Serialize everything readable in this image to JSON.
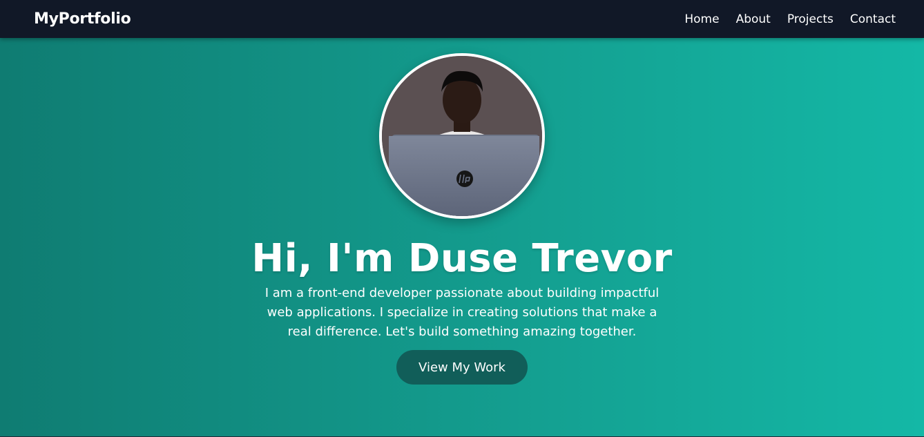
{
  "navbar": {
    "brand": "MyPortfolio",
    "links": [
      "Home",
      "About",
      "Projects",
      "Contact"
    ]
  },
  "hero": {
    "avatar_alt": "Profile photo",
    "title": "Hi, I'm Duse Trevor",
    "description": "I am a front-end developer passionate about building impactful web applications. I specialize in creating solutions that make a real difference. Let's build something amazing together.",
    "cta_label": "View My Work"
  },
  "colors": {
    "navbar_bg": "#111827",
    "hero_gradient_start": "#0f7c72",
    "hero_gradient_end": "#14b8a6",
    "cta_bg": "#115e59",
    "text": "#ffffff"
  }
}
